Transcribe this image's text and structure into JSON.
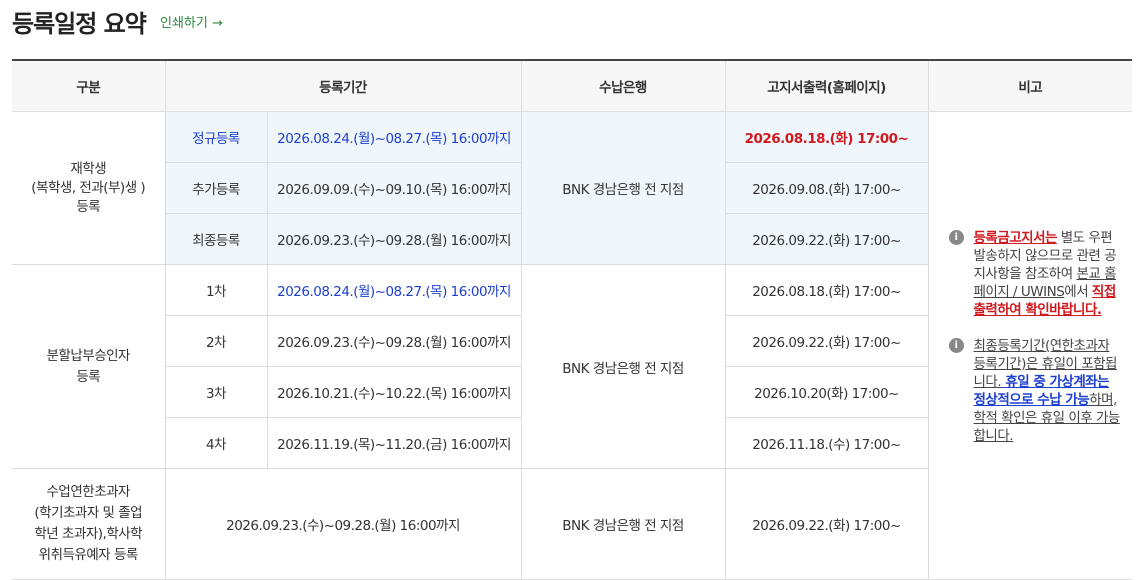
{
  "header": {
    "title": "등록일정 요약",
    "print_label": "인쇄하기 →"
  },
  "columns": [
    "구분",
    "등록기간",
    "수납은행",
    "고지서출력(홈페이지)",
    "비고"
  ],
  "groups": {
    "enrolled": {
      "label_lines": [
        "재학생",
        "(복학생, 전과(부)생 )",
        "등록"
      ],
      "bank": "BNK 경남은행 전 지점",
      "rows": [
        {
          "sub": "정규등록",
          "period": "2026.08.24.(월)~08.27.(목) 16:00까지",
          "notice": "2026.08.18.(화) 17:00~"
        },
        {
          "sub": "추가등록",
          "period": "2026.09.09.(수)~09.10.(목) 16:00까지",
          "notice": "2026.09.08.(화) 17:00~"
        },
        {
          "sub": "최종등록",
          "period": "2026.09.23.(수)~09.28.(월) 16:00까지",
          "notice": "2026.09.22.(화) 17:00~"
        }
      ]
    },
    "installment": {
      "label_lines": [
        "분할납부승인자",
        "등록"
      ],
      "bank": "BNK 경남은행 전 지점",
      "rows": [
        {
          "sub": "1차",
          "period": "2026.08.24.(월)~08.27.(목) 16:00까지",
          "notice": "2026.08.18.(화) 17:00~"
        },
        {
          "sub": "2차",
          "period": "2026.09.23.(수)~09.28.(월) 16:00까지",
          "notice": "2026.09.22.(화) 17:00~"
        },
        {
          "sub": "3차",
          "period": "2026.10.21.(수)~10.22.(목) 16:00까지",
          "notice": "2026.10.20(화) 17:00~"
        },
        {
          "sub": "4차",
          "period": "2026.11.19.(목)~11.20.(금) 16:00까지",
          "notice": "2026.11.18.(수) 17:00~"
        }
      ]
    },
    "extra": {
      "label_lines": [
        "수업연한초과자",
        "(학기초과자 및 졸업",
        "학년 초과자),학사학",
        "위취득유예자 등록"
      ],
      "period": "2026.09.23.(수)~09.28.(월) 16:00까지",
      "bank": "BNK 경남은행 전 지점",
      "notice": "2026.09.22.(화) 17:00~"
    }
  },
  "notes": {
    "note1": {
      "part1": "등록금고지서는",
      "part2": " 별도 우편발송하지 않으므로 관련 공지사항을 참조하여 ",
      "part3": "본교 홈페이지 / UWINS",
      "part4": "에서 ",
      "part5": "직접 출력하여 확인바랍니다."
    },
    "note2": {
      "part1": "최종등록기간(연한초과자등록기간)은 휴일이 포함됩니다.",
      "part2": " 휴일 중 가상계좌는 정상적으로 수납 가능",
      "part3": "하며, 학적 확인은 휴일 이후 가능합니다."
    }
  },
  "colors": {
    "blue": "#1d3fd0",
    "red": "#d0191f",
    "highlight": "#f0f7fc",
    "print_link": "#2a8a3a"
  }
}
